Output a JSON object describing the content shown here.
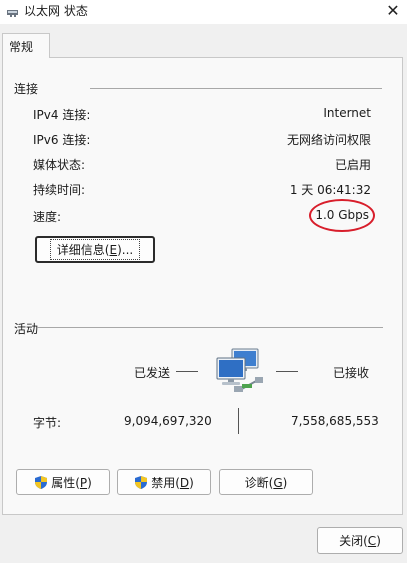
{
  "window": {
    "title": "以太网 状态",
    "close_glyph": "✕"
  },
  "tabs": [
    {
      "label": "常规"
    }
  ],
  "connection": {
    "heading": "连接",
    "rows": [
      {
        "label": "IPv4 连接:",
        "value": "Internet"
      },
      {
        "label": "IPv6 连接:",
        "value": "无网络访问权限"
      },
      {
        "label": "媒体状态:",
        "value": "已启用"
      },
      {
        "label": "持续时间:",
        "value": "1 天 06:41:32"
      },
      {
        "label": "速度:",
        "value": "1.0 Gbps"
      }
    ],
    "details_button": {
      "text": "详细信息(",
      "hotkey": "E",
      "suffix": ")..."
    }
  },
  "activity": {
    "heading": "活动",
    "sent_label": "已发送",
    "received_label": "已接收",
    "bytes_label": "字节:",
    "bytes_sent": "9,094,697,320",
    "bytes_received": "7,558,685,553"
  },
  "buttons": {
    "properties": {
      "text": "属性(",
      "hotkey": "P",
      "suffix": ")"
    },
    "disable": {
      "text": "禁用(",
      "hotkey": "D",
      "suffix": ")"
    },
    "diagnose": {
      "text": "诊断(",
      "hotkey": "G",
      "suffix": ")"
    },
    "close": {
      "text": "关闭(",
      "hotkey": "C",
      "suffix": ")"
    }
  },
  "colors": {
    "annotation_circle": "#d81e2b",
    "shield_blue": "#2a6bd1",
    "shield_yellow": "#f3c623"
  },
  "icons": {
    "window": "network-adapter-icon",
    "activity": "network-computers-icon",
    "uac": "shield-icon"
  }
}
